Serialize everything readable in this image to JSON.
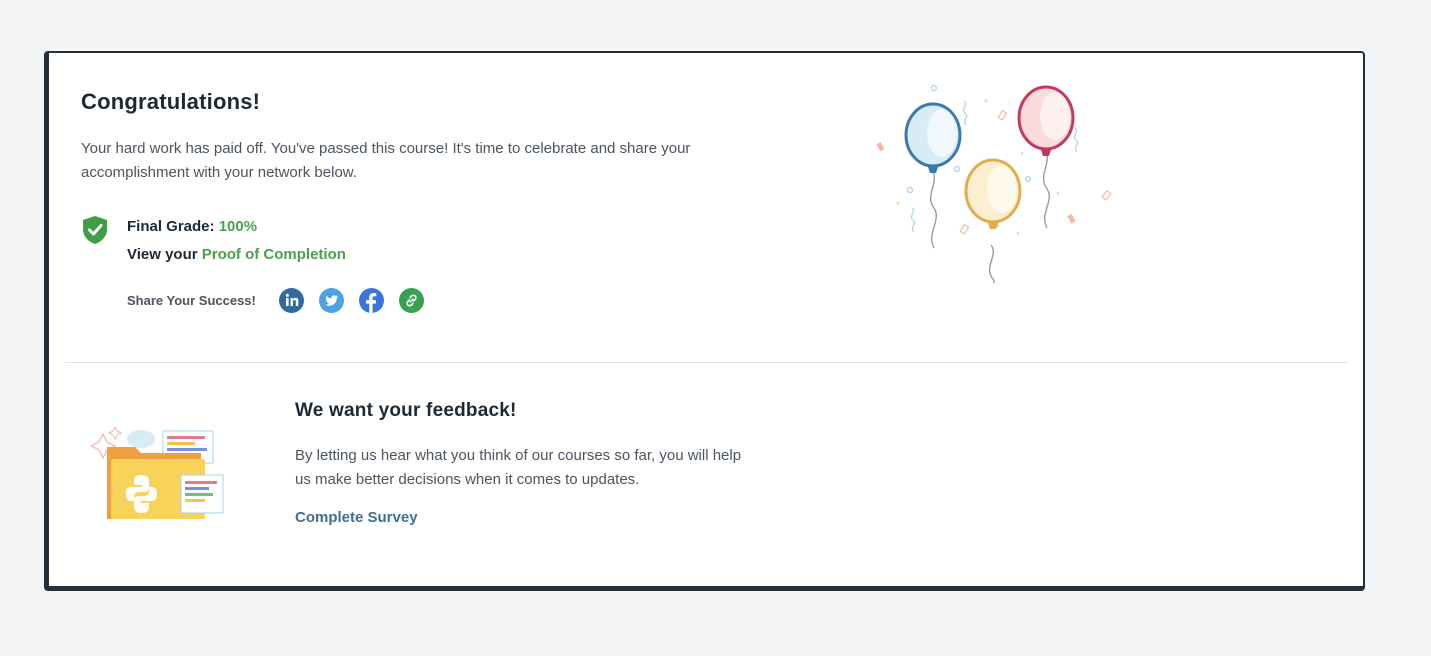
{
  "congrats": {
    "title": "Congratulations!",
    "message": "Your hard work has paid off. You've passed this course! It's time to celebrate and share your accomplishment with your network below."
  },
  "grade": {
    "label": "Final Grade:",
    "value": "100%",
    "proof_prefix": "View your",
    "proof_link": "Proof of Completion"
  },
  "share": {
    "label": "Share Your Success!",
    "icons": [
      "linkedin-icon",
      "twitter-icon",
      "facebook-icon",
      "link-icon"
    ]
  },
  "feedback": {
    "title": "We want your feedback!",
    "message": "By letting us hear what you think of our courses so far, you will help us make better decisions when it comes to updates.",
    "cta": "Complete Survey"
  },
  "colors": {
    "accent_green": "#4aa04e",
    "link_blue": "#3f6f93",
    "linkedin": "#2f6aa0",
    "twitter": "#4ba3e3",
    "facebook": "#3b74db",
    "copy_link": "#3aa150"
  }
}
